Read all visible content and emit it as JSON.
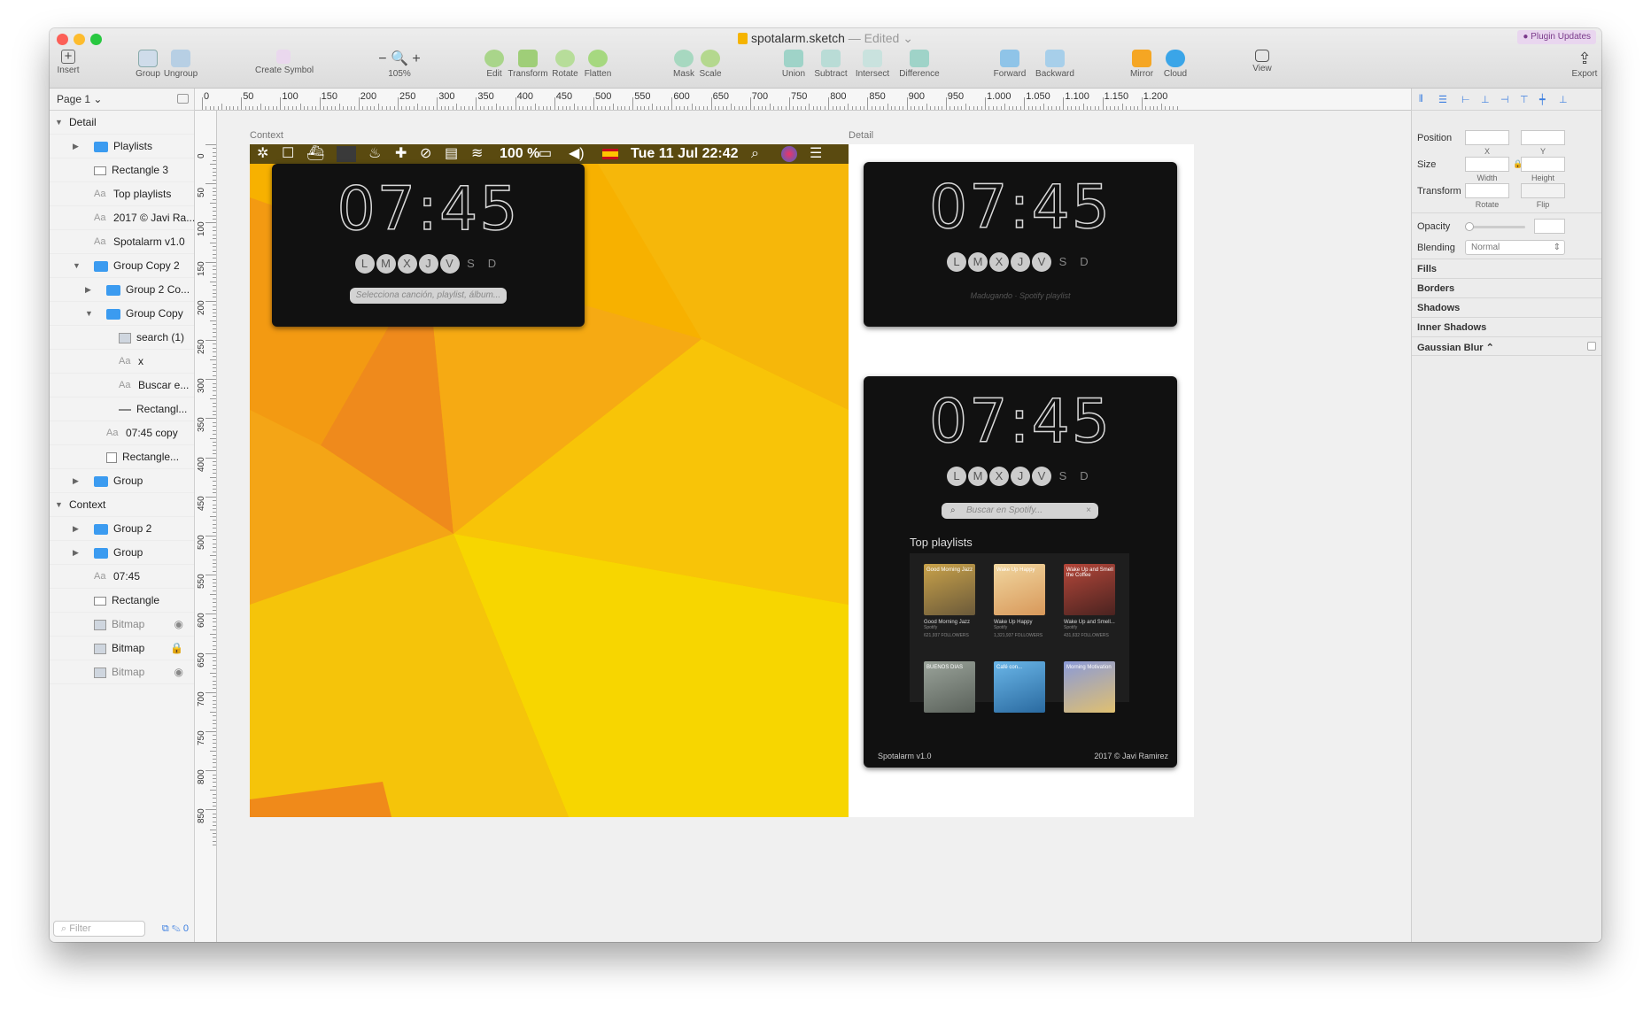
{
  "window": {
    "title": "spotalarm.sketch",
    "edited": "— Edited ⌄",
    "plugin_badge": "● Plugin Updates"
  },
  "toolbar": {
    "insert": "Insert",
    "group": "Group",
    "ungroup": "Ungroup",
    "create_symbol": "Create Symbol",
    "zoom": "105%",
    "edit": "Edit",
    "transform": "Transform",
    "rotate": "Rotate",
    "flatten": "Flatten",
    "mask": "Mask",
    "scale": "Scale",
    "union": "Union",
    "subtract": "Subtract",
    "intersect": "Intersect",
    "difference": "Difference",
    "forward": "Forward",
    "backward": "Backward",
    "mirror": "Mirror",
    "cloud": "Cloud",
    "view": "View",
    "export": "Export"
  },
  "ruler": {
    "h": [
      "0",
      "50",
      "100",
      "150",
      "200",
      "250",
      "300",
      "350",
      "400",
      "450",
      "500",
      "550",
      "600",
      "650",
      "700",
      "750",
      "800",
      "850",
      "900",
      "950",
      "1.000",
      "1.050",
      "1.100",
      "1.150",
      "1.200"
    ],
    "v": [
      "0",
      "50",
      "100",
      "150",
      "200",
      "250",
      "300",
      "350",
      "400",
      "450",
      "500",
      "550",
      "600",
      "650",
      "700",
      "750",
      "800",
      "850"
    ]
  },
  "layers": {
    "page": "Page 1 ⌄",
    "filter_placeholder": "Filter",
    "filter_count": "0",
    "items": [
      {
        "label": "Detail",
        "indent": 0,
        "type": "section",
        "arrow": "▼"
      },
      {
        "label": "Playlists",
        "indent": 1,
        "type": "folder",
        "arrow": "▶"
      },
      {
        "label": "Rectangle 3",
        "indent": 1,
        "type": "rect",
        "arrow": ""
      },
      {
        "label": "Top playlists",
        "indent": 1,
        "type": "text",
        "arrow": ""
      },
      {
        "label": "2017 © Javi Ra...",
        "indent": 1,
        "type": "text",
        "arrow": ""
      },
      {
        "label": "Spotalarm v1.0",
        "indent": 1,
        "type": "text",
        "arrow": ""
      },
      {
        "label": "Group Copy 2",
        "indent": 1,
        "type": "folder",
        "arrow": "▼"
      },
      {
        "label": "Group 2 Co...",
        "indent": 2,
        "type": "folder",
        "arrow": "▶"
      },
      {
        "label": "Group Copy",
        "indent": 2,
        "type": "folder",
        "arrow": "▼"
      },
      {
        "label": "search (1)",
        "indent": 3,
        "type": "img",
        "arrow": ""
      },
      {
        "label": "x",
        "indent": 3,
        "type": "text",
        "arrow": ""
      },
      {
        "label": "Buscar e...",
        "indent": 3,
        "type": "text",
        "arrow": ""
      },
      {
        "label": "Rectangl...",
        "indent": 3,
        "type": "line",
        "arrow": ""
      },
      {
        "label": "07:45 copy",
        "indent": 2,
        "type": "text",
        "arrow": ""
      },
      {
        "label": "Rectangle...",
        "indent": 2,
        "type": "sqr",
        "arrow": ""
      },
      {
        "label": "Group",
        "indent": 1,
        "type": "folder",
        "arrow": "▶"
      },
      {
        "label": "Context",
        "indent": 0,
        "type": "section",
        "arrow": "▼"
      },
      {
        "label": "Group 2",
        "indent": 1,
        "type": "folder",
        "arrow": "▶"
      },
      {
        "label": "Group",
        "indent": 1,
        "type": "folder",
        "arrow": "▶"
      },
      {
        "label": "07:45",
        "indent": 1,
        "type": "text",
        "arrow": ""
      },
      {
        "label": "Rectangle",
        "indent": 1,
        "type": "rect",
        "arrow": ""
      },
      {
        "label": "Bitmap",
        "indent": 1,
        "type": "img",
        "arrow": "",
        "dim": true,
        "right": "eye-icon"
      },
      {
        "label": "Bitmap",
        "indent": 1,
        "type": "img",
        "arrow": "",
        "right": "lock-icon"
      },
      {
        "label": "Bitmap",
        "indent": 1,
        "type": "img",
        "arrow": "",
        "dim": true,
        "right": "eye-icon"
      }
    ]
  },
  "canvas": {
    "context_label": "Context",
    "detail_label": "Detail",
    "menubar": {
      "battery": "100 %",
      "datetime": "Tue 11 Jul  22:42"
    },
    "clock": "07:45",
    "days": [
      {
        "l": "L",
        "on": true
      },
      {
        "l": "M",
        "on": true
      },
      {
        "l": "X",
        "on": true
      },
      {
        "l": "J",
        "on": true
      },
      {
        "l": "V",
        "on": true
      },
      {
        "l": "S",
        "on": false
      },
      {
        "l": "D",
        "on": false
      }
    ],
    "context_search_placeholder": "Selecciona canción, playlist, álbum...",
    "detail_playlist_line": "Madugando · Spotify playlist",
    "detail_search_placeholder": "Buscar en Spotify...",
    "search_clear": "×",
    "top_playlists": "Top playlists",
    "playlists": [
      {
        "cover": "Good Morning Jazz",
        "name": "Good Morning Jazz",
        "owner": "Spotify",
        "followers": "621,937 FOLLOWERS",
        "color1": "#c9a24a",
        "color2": "#6b5a3a"
      },
      {
        "cover": "Wake Up Happy",
        "name": "Wake Up Happy",
        "owner": "Spotify",
        "followers": "1,321,937 FOLLOWERS",
        "color1": "#f1d7a0",
        "color2": "#d8985a"
      },
      {
        "cover": "Wake Up and Smell the Coffee",
        "name": "Wake Up and Smell...",
        "owner": "Spotify",
        "followers": "431,632 FOLLOWERS",
        "color1": "#b5473a",
        "color2": "#4a2320"
      },
      {
        "cover": "BUENOS DIAS",
        "name": "",
        "owner": "",
        "followers": "",
        "color1": "#9aa39a",
        "color2": "#5a615a"
      },
      {
        "cover": "Café con...",
        "name": "",
        "owner": "",
        "followers": "",
        "color1": "#6ab6e8",
        "color2": "#2a6aa0"
      },
      {
        "cover": "Morning Motivation",
        "name": "",
        "owner": "",
        "followers": "",
        "color1": "#8a9ad8",
        "color2": "#e0c070"
      }
    ],
    "footer_left": "Spotalarm v1.0",
    "footer_right": "2017 © Javi Ramirez"
  },
  "inspector": {
    "position": "Position",
    "x": "X",
    "y": "Y",
    "size": "Size",
    "width": "Width",
    "height": "Height",
    "transform": "Transform",
    "rotate": "Rotate",
    "flip": "Flip",
    "opacity": "Opacity",
    "blending": "Blending",
    "blending_value": "Normal",
    "fills": "Fills",
    "borders": "Borders",
    "shadows": "Shadows",
    "inner_shadows": "Inner Shadows",
    "gaussian_blur": "Gaussian Blur ⌃"
  },
  "colors": {
    "accent": "#3b7ee0",
    "folder": "#3b9bf0",
    "wallpaper1": "#f7b500",
    "wallpaper2": "#f08a1a",
    "panel": "#111111"
  }
}
